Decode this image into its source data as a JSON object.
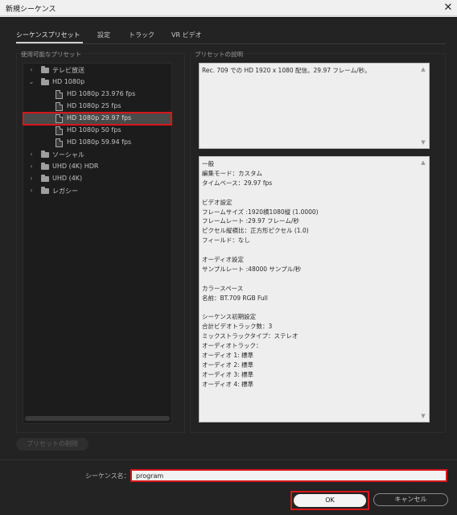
{
  "window": {
    "title": "新規シーケンス",
    "close_glyph": "✕"
  },
  "tabs": [
    {
      "label": "シーケンスプリセット",
      "active": true
    },
    {
      "label": "設定",
      "active": false
    },
    {
      "label": "トラック",
      "active": false
    },
    {
      "label": "VR ビデオ",
      "active": false
    }
  ],
  "presets": {
    "header": "使用可能なプリセット",
    "items": [
      {
        "label": "テレビ放送",
        "type": "folder",
        "expanded": false
      },
      {
        "label": "HD 1080p",
        "type": "folder",
        "expanded": true
      },
      {
        "label": "HD 1080p 23.976 fps",
        "type": "preset"
      },
      {
        "label": "HD 1080p 25 fps",
        "type": "preset"
      },
      {
        "label": "HD 1080p 29.97 fps",
        "type": "preset",
        "selected": true
      },
      {
        "label": "HD 1080p 50 fps",
        "type": "preset"
      },
      {
        "label": "HD 1080p 59.94 fps",
        "type": "preset"
      },
      {
        "label": "ソーシャル",
        "type": "folder",
        "expanded": false
      },
      {
        "label": "UHD (4K) HDR",
        "type": "folder",
        "expanded": false
      },
      {
        "label": "UHD (4K)",
        "type": "folder",
        "expanded": false
      },
      {
        "label": "レガシー",
        "type": "folder",
        "expanded": false
      }
    ],
    "delete_button": "プリセットの削除"
  },
  "description": {
    "header": "プリセットの説明",
    "text": "Rec. 709 での HD 1920 x 1080 配信。29.97 フレーム/秒。"
  },
  "details": [
    "一般",
    " 編集モード：カスタム",
    " タイムベース：29.97 fps",
    "",
    "ビデオ設定",
    " フレームサイズ :1920横1080縦 (1.0000)",
    " フレームレート :29.97  フレーム/秒",
    " ピクセル縦横比：正方形ピクセル (1.0)",
    " フィールド：なし",
    "",
    "オーディオ設定",
    " サンプルレート :48000 サンプル/秒",
    "",
    "カラースペース",
    " 名前：BT.709 RGB Full",
    "",
    "シーケンス初期設定",
    " 合計ビデオトラック数：3",
    " ミックストラックタイプ：ステレオ",
    " オーディオトラック：",
    " オーディオ 1: 標準",
    " オーディオ 2: 標準",
    " オーディオ 3: 標準",
    " オーディオ 4: 標準"
  ],
  "sequence_name": {
    "label": "シーケンス名：",
    "value": "program"
  },
  "buttons": {
    "ok": "OK",
    "cancel": "キャンセル"
  },
  "colors": {
    "highlight": "#d8161c",
    "dialog_bg": "#232323"
  }
}
